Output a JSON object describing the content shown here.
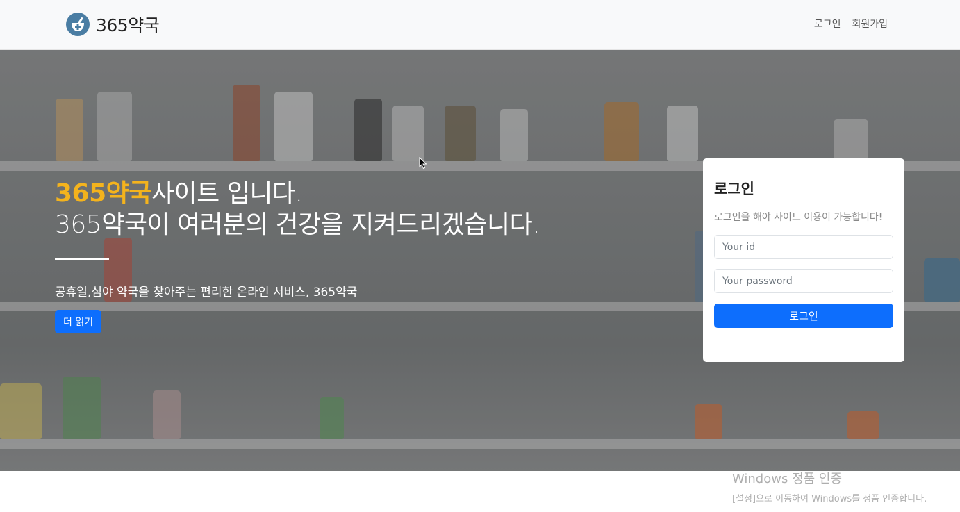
{
  "brand": {
    "name": "365약국",
    "logo_icon": "pharmacy-mortar-icon"
  },
  "nav": {
    "login": "로그인",
    "signup": "회원가입"
  },
  "hero": {
    "title_accent": "365약국",
    "title_rest": "사이트 입니다.",
    "title_line2": "365약국이 여러분의 건강을 지켜드리겠습니다.",
    "subtitle": "공휴일,심야 약국을 찾아주는 편리한 온라인 서비스, 365약국",
    "read_more": "더 읽기"
  },
  "login": {
    "title": "로그인",
    "description": "로그인을 해야 사이트 이용이 가능합니다!",
    "id_placeholder": "Your id",
    "password_placeholder": "Your password",
    "submit": "로그인"
  },
  "watermark": {
    "title": "Windows 정품 인증",
    "subtitle": "[설정]으로 이동하여 Windows를 정품 인증합니다."
  },
  "colors": {
    "accent": "#f4b31d",
    "primary": "#0d6efd",
    "logo": "#4a7da3"
  }
}
